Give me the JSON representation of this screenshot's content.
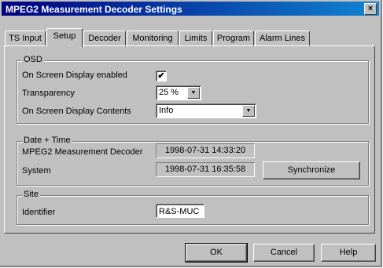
{
  "window": {
    "title": "MPEG2 Measurement Decoder Settings",
    "close_glyph": "×"
  },
  "tabs": [
    {
      "label": "TS Input",
      "active": false
    },
    {
      "label": "Setup",
      "active": true
    },
    {
      "label": "Decoder",
      "active": false
    },
    {
      "label": "Monitoring",
      "active": false
    },
    {
      "label": "Limits",
      "active": false
    },
    {
      "label": "Program",
      "active": false
    },
    {
      "label": "Alarm Lines",
      "active": false
    }
  ],
  "osd": {
    "group_label": "OSD",
    "enabled_label": "On Screen Display enabled",
    "enabled_checked": true,
    "check_glyph": "✔",
    "transparency_label": "Transparency",
    "transparency_value": "25 %",
    "contents_label": "On Screen Display Contents",
    "contents_value": "Info",
    "dropdown_glyph": "▼"
  },
  "datetime": {
    "group_label": "Date + Time",
    "decoder_label": "MPEG2 Measurement Decoder",
    "decoder_value": "1998-07-31  14:33:20",
    "system_label": "System",
    "system_value": "1998-07-31  16:35:58",
    "sync_label": "Synchronize"
  },
  "site": {
    "group_label": "Site",
    "identifier_label": "Identifier",
    "identifier_value": "R&S-MUC"
  },
  "footer": {
    "ok_label": "OK",
    "cancel_label": "Cancel",
    "help_label": "Help"
  }
}
